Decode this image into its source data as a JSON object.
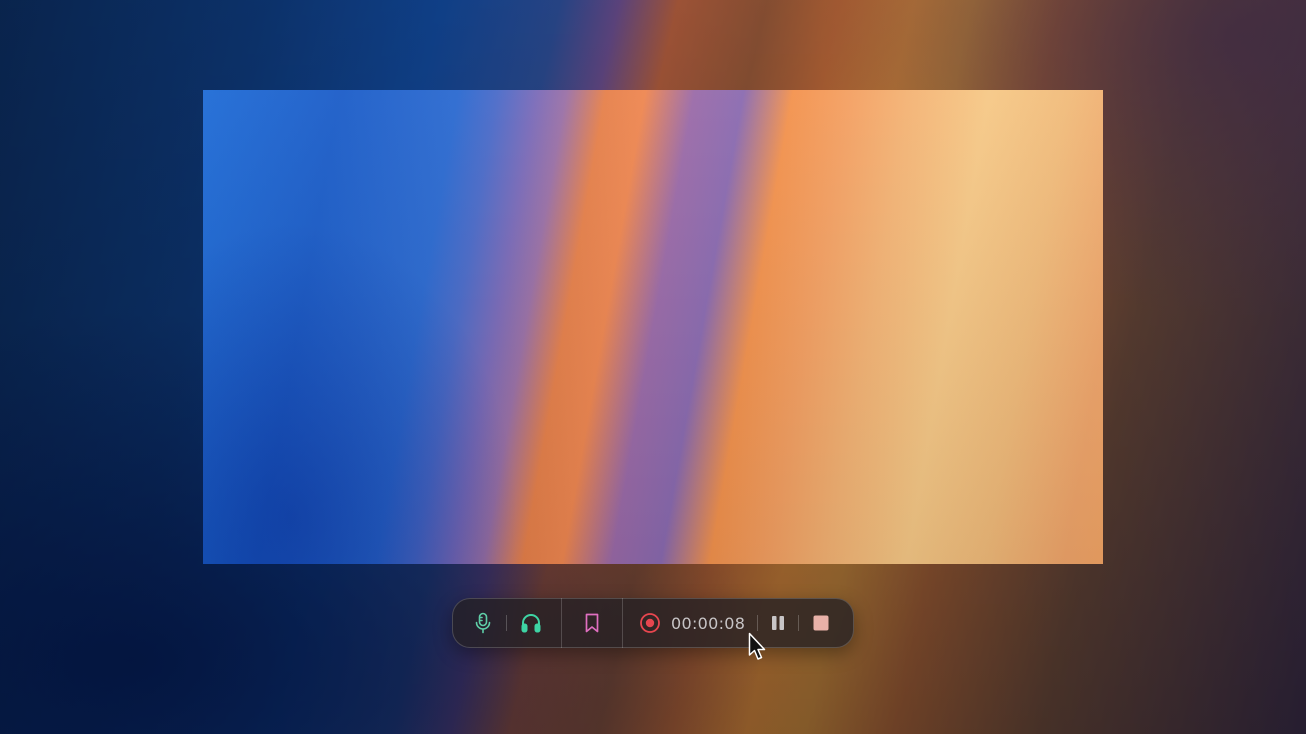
{
  "selection_area": {
    "accent_colors": [
      "#1e6bd6",
      "#8a6ab0",
      "#f3924d",
      "#f6c886"
    ]
  },
  "toolbar": {
    "microphone_icon": "microphone-icon",
    "headphones_icon": "headphones-icon",
    "bookmark_icon": "bookmark-icon",
    "record_icon": "record-icon",
    "timer": "00:00:08",
    "pause_icon": "pause-icon",
    "stop_icon": "stop-icon",
    "colors": {
      "microphone": "#5fcfa8",
      "headphones": "#3ed4a4",
      "bookmark": "#e06fc0",
      "record": "#e8464f",
      "pause": "#c8c5c7",
      "stop": "#e8b1a8"
    }
  },
  "cursor": {
    "icon": "mouse-pointer-icon"
  }
}
